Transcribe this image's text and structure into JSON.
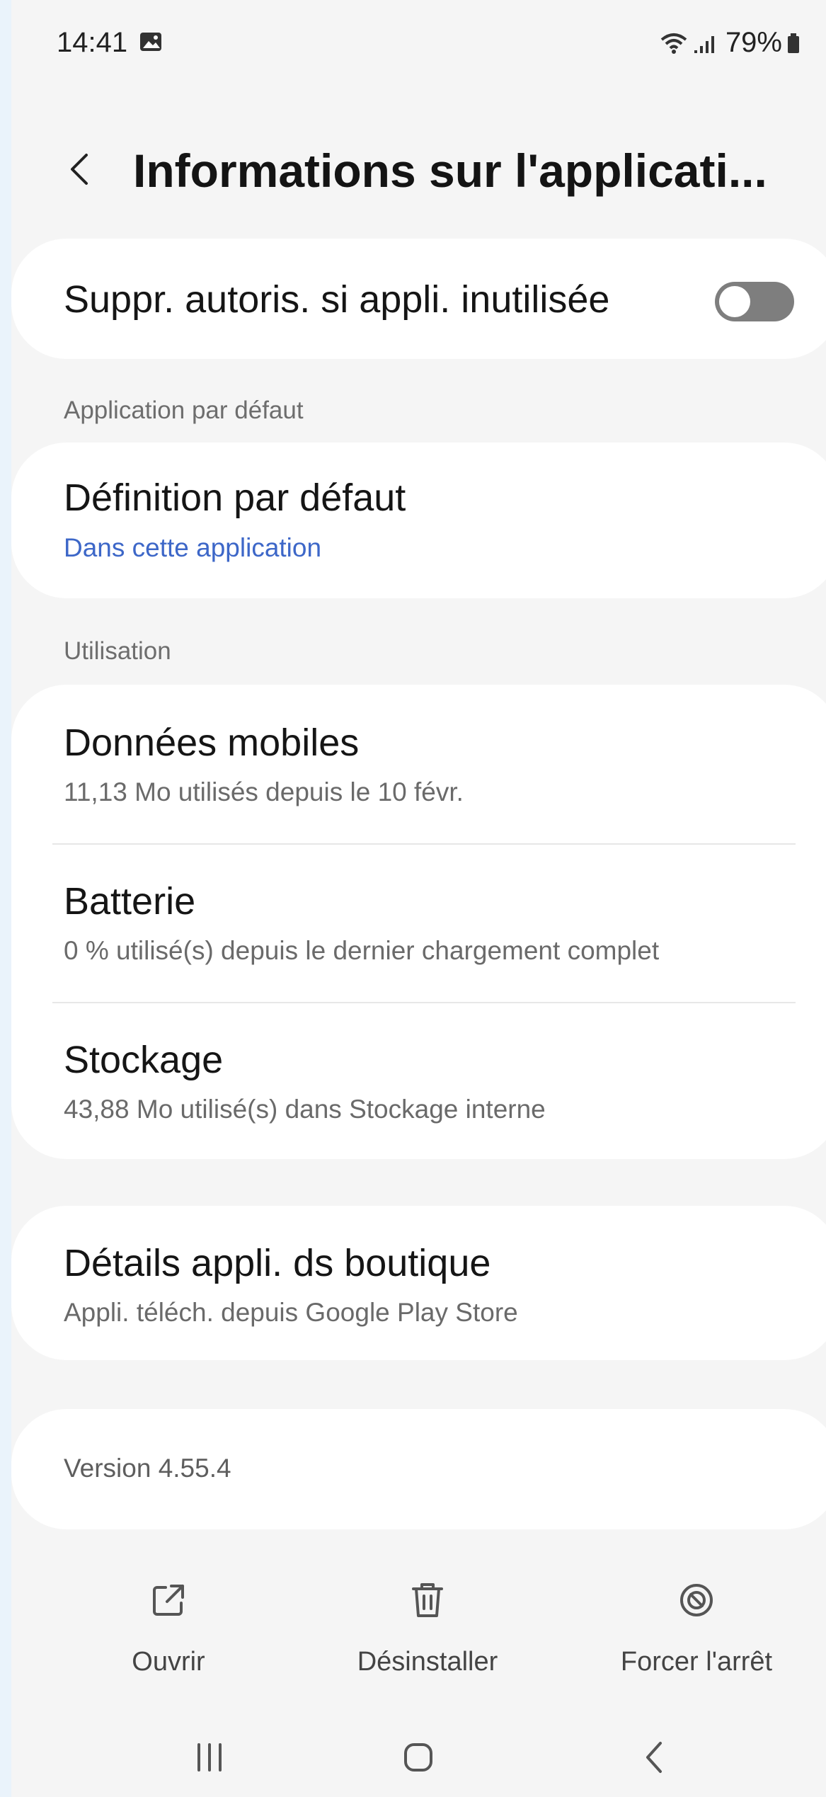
{
  "status_bar": {
    "time": "14:41",
    "battery_percent": "79%",
    "icons": [
      "gallery-icon",
      "wifi-icon",
      "signal-icon",
      "battery-icon"
    ]
  },
  "header": {
    "back_icon": "chevron-left-icon",
    "title": "Informations sur l'applicati..."
  },
  "permissions_toggle": {
    "label": "Suppr. autoris. si appli. inutilisée",
    "enabled": false
  },
  "default_app_section": {
    "heading": "Application par défaut",
    "item": {
      "title": "Définition par défaut",
      "subtitle": "Dans cette application"
    }
  },
  "usage_section": {
    "heading": "Utilisation",
    "items": [
      {
        "title": "Données mobiles",
        "subtitle": "11,13 Mo utilisés depuis le 10 févr."
      },
      {
        "title": "Batterie",
        "subtitle": "0 % utilisé(s) depuis le dernier chargement complet"
      },
      {
        "title": "Stockage",
        "subtitle": "43,88 Mo utilisé(s) dans Stockage interne"
      }
    ]
  },
  "store_details": {
    "title": "Détails appli. ds boutique",
    "subtitle": "Appli. téléch. depuis Google Play Store"
  },
  "version_text": "Version 4.55.4",
  "actions": [
    {
      "label": "Ouvrir",
      "icon": "open-external-icon"
    },
    {
      "label": "Désinstaller",
      "icon": "trash-icon"
    },
    {
      "label": "Forcer l'arrêt",
      "icon": "force-stop-icon"
    }
  ],
  "nav_bar": {
    "icons": [
      "recent-apps-icon",
      "home-icon",
      "back-icon"
    ]
  },
  "colors": {
    "page_background": "#f5f5f5",
    "card_background": "#ffffff",
    "link_blue": "#3d67c8",
    "toggle_off": "#7e7e7e"
  }
}
